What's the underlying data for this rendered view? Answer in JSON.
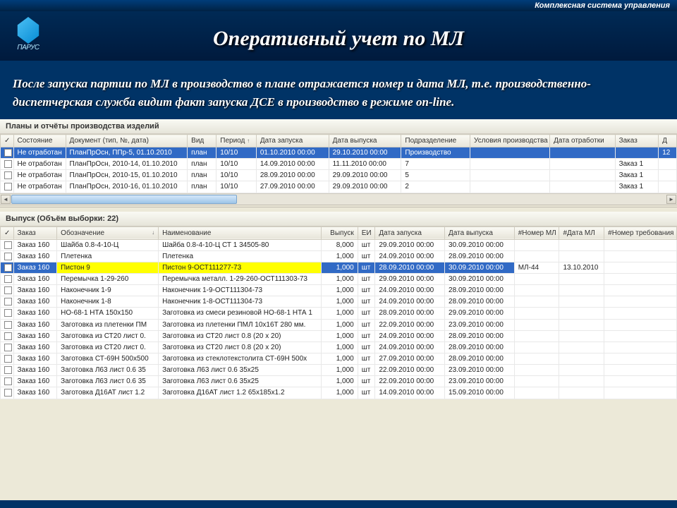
{
  "system_name": "Комплексная система управления",
  "company_name": "ПАРУС",
  "page_title": "Оперативный учет по МЛ",
  "description": "После запуска партии по МЛ в производство в плане отражается номер и дата МЛ, т.е. производственно-диспетчерская служба видит факт запуска ДСЕ в производство в режиме on-line.",
  "top_panel": {
    "title": "Планы и отчёты производства изделий",
    "columns": [
      "",
      "Состояние",
      "Документ (тип, №, дата)",
      "Вид",
      "Период",
      "Дата запуска",
      "Дата выпуска",
      "Подразделение",
      "Условия производства",
      "Дата отработки",
      "Заказ",
      "Д"
    ],
    "rows": [
      {
        "selected": true,
        "state": "Не отработан",
        "doc": "ПланПрОсн, ППр-5, 01.10.2010",
        "kind": "план",
        "period": "10/10",
        "start": "01.10.2010 00:00",
        "end": "29.10.2010 00:00",
        "unit": "Производство",
        "cond": "",
        "proc": "",
        "order": "",
        "extra": "12"
      },
      {
        "selected": false,
        "state": "Не отработан",
        "doc": "ПланПрОсн, 2010-14, 01.10.2010",
        "kind": "план",
        "period": "10/10",
        "start": "14.09.2010 00:00",
        "end": "11.11.2010 00:00",
        "unit": "7",
        "cond": "",
        "proc": "",
        "order": "Заказ 1",
        "extra": ""
      },
      {
        "selected": false,
        "state": "Не отработан",
        "doc": "ПланПрОсн, 2010-15, 01.10.2010",
        "kind": "план",
        "period": "10/10",
        "start": "28.09.2010 00:00",
        "end": "29.09.2010 00:00",
        "unit": "5",
        "cond": "",
        "proc": "",
        "order": "Заказ 1",
        "extra": ""
      },
      {
        "selected": false,
        "state": "Не отработан",
        "doc": "ПланПрОсн, 2010-16, 01.10.2010",
        "kind": "план",
        "period": "10/10",
        "start": "27.09.2010 00:00",
        "end": "29.09.2010 00:00",
        "unit": "2",
        "cond": "",
        "proc": "",
        "order": "Заказ 1",
        "extra": ""
      }
    ]
  },
  "bottom_panel": {
    "title": "Выпуск (Объём выборки: 22)",
    "columns": [
      "",
      "Заказ",
      "Обозначение",
      "Наименование",
      "Выпуск",
      "ЕИ",
      "Дата запуска",
      "Дата выпуска",
      "#Номер МЛ",
      "#Дата МЛ",
      "#Номер требования"
    ],
    "rows": [
      {
        "order": "Заказ 160",
        "desig": "Шайба 0.8-4-10-Ц",
        "name": "Шайба 0.8-4-10-Ц СТ 1 34505-80",
        "qty": "8,000",
        "unit": "шт",
        "start": "29.09.2010 00:00",
        "end": "30.09.2010 00:00",
        "ml": "",
        "mldate": "",
        "req": ""
      },
      {
        "order": "Заказ 160",
        "desig": "Плетенка",
        "name": "Плетенка",
        "qty": "1,000",
        "unit": "шт",
        "start": "24.09.2010 00:00",
        "end": "28.09.2010 00:00",
        "ml": "",
        "mldate": "",
        "req": ""
      },
      {
        "highlight": true,
        "order": "Заказ 160",
        "desig": "Пистон 9",
        "name": "Пистон 9-ОСТ111277-73",
        "qty": "1,000",
        "unit": "шт",
        "start": "28.09.2010 00:00",
        "end": "30.09.2010 00:00",
        "ml": "МЛ-44",
        "mldate": "13.10.2010",
        "req": ""
      },
      {
        "order": "Заказ 160",
        "desig": "Перемычка 1-29-260",
        "name": "Перемычка металл. 1-29-260-ОСТ111303-73",
        "qty": "1,000",
        "unit": "шт",
        "start": "29.09.2010 00:00",
        "end": "30.09.2010 00:00",
        "ml": "",
        "mldate": "",
        "req": ""
      },
      {
        "order": "Заказ 160",
        "desig": "Наконечник 1-9",
        "name": "Наконечник 1-9-ОСТ111304-73",
        "qty": "1,000",
        "unit": "шт",
        "start": "24.09.2010 00:00",
        "end": "28.09.2010 00:00",
        "ml": "",
        "mldate": "",
        "req": ""
      },
      {
        "order": "Заказ 160",
        "desig": "Наконечник 1-8",
        "name": "Наконечник 1-8-ОСТ111304-73",
        "qty": "1,000",
        "unit": "шт",
        "start": "24.09.2010 00:00",
        "end": "28.09.2010 00:00",
        "ml": "",
        "mldate": "",
        "req": ""
      },
      {
        "order": "Заказ 160",
        "desig": "НО-68-1 НТА 150x150",
        "name": "Заготовка из смеси резиновой НО-68-1 НТА 1",
        "qty": "1,000",
        "unit": "шт",
        "start": "28.09.2010 00:00",
        "end": "29.09.2010 00:00",
        "ml": "",
        "mldate": "",
        "req": ""
      },
      {
        "order": "Заказ 160",
        "desig": "Заготовка из плетенки ПМ",
        "name": "Заготовка из плетенки ПМЛ 10x16Т 280 мм.",
        "qty": "1,000",
        "unit": "шт",
        "start": "22.09.2010 00:00",
        "end": "23.09.2010 00:00",
        "ml": "",
        "mldate": "",
        "req": ""
      },
      {
        "order": "Заказ 160",
        "desig": "Заготовка из СТ20 лист 0.",
        "name": "Заготовка из СТ20 лист 0.8 (20 x 20)",
        "qty": "1,000",
        "unit": "шт",
        "start": "24.09.2010 00:00",
        "end": "28.09.2010 00:00",
        "ml": "",
        "mldate": "",
        "req": ""
      },
      {
        "order": "Заказ 160",
        "desig": "Заготовка из СТ20 лист 0.",
        "name": "Заготовка из СТ20 лист 0.8 (20 x 20)",
        "qty": "1,000",
        "unit": "шт",
        "start": "24.09.2010 00:00",
        "end": "28.09.2010 00:00",
        "ml": "",
        "mldate": "",
        "req": ""
      },
      {
        "order": "Заказ 160",
        "desig": "Заготовка СТ-69Н 500x500",
        "name": "Заготовка из стеклотекстолита СТ-69Н 500x",
        "qty": "1,000",
        "unit": "шт",
        "start": "27.09.2010 00:00",
        "end": "28.09.2010 00:00",
        "ml": "",
        "mldate": "",
        "req": ""
      },
      {
        "order": "Заказ 160",
        "desig": "Заготовка Л63 лист 0.6 35",
        "name": "Заготовка Л63 лист 0.6 35x25",
        "qty": "1,000",
        "unit": "шт",
        "start": "22.09.2010 00:00",
        "end": "23.09.2010 00:00",
        "ml": "",
        "mldate": "",
        "req": ""
      },
      {
        "order": "Заказ 160",
        "desig": "Заготовка Л63 лист 0.6 35",
        "name": "Заготовка Л63 лист 0.6 35x25",
        "qty": "1,000",
        "unit": "шт",
        "start": "22.09.2010 00:00",
        "end": "23.09.2010 00:00",
        "ml": "",
        "mldate": "",
        "req": ""
      },
      {
        "order": "Заказ 160",
        "desig": "Заготовка Д16АТ лист 1.2",
        "name": "Заготовка Д16АТ лист 1.2 65x185x1.2",
        "qty": "1,000",
        "unit": "шт",
        "start": "14.09.2010 00:00",
        "end": "15.09.2010 00:00",
        "ml": "",
        "mldate": "",
        "req": ""
      }
    ]
  }
}
